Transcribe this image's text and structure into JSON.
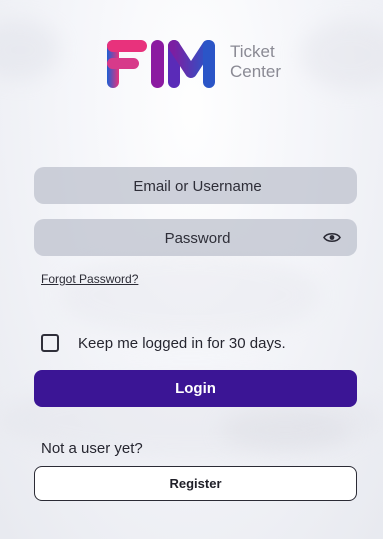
{
  "brand": {
    "logo_text_line1": "Ticket",
    "logo_text_line2": "Center",
    "colors": {
      "pink": "#e8327c",
      "purple": "#8b1aa1",
      "blue": "#2b55c7",
      "accent": "#3b1595"
    }
  },
  "login": {
    "email_placeholder": "Email or Username",
    "password_placeholder": "Password",
    "forgot_password": "Forgot Password?",
    "keep_logged_in": "Keep me logged in for 30 days.",
    "login_button": "Login"
  },
  "register": {
    "prompt": "Not a user yet?",
    "button": "Register"
  },
  "icons": {
    "password_toggle": "eye-icon"
  }
}
